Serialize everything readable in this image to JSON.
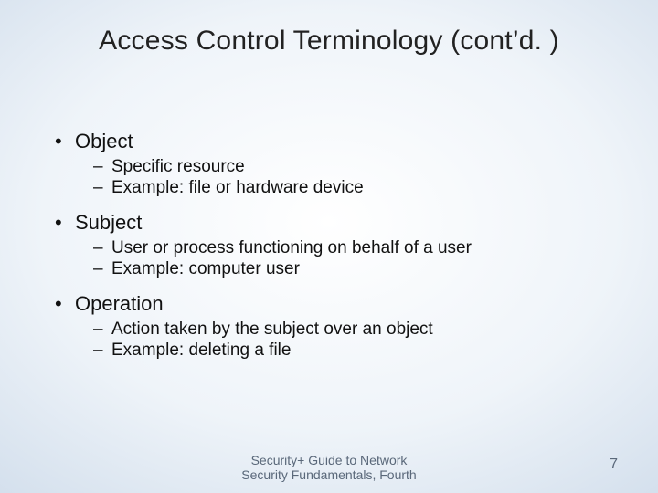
{
  "title": "Access Control Terminology (cont’d. )",
  "bullets": [
    {
      "label": "Object",
      "subs": [
        "Specific resource",
        "Example: file or hardware device"
      ]
    },
    {
      "label": "Subject",
      "subs": [
        "User or process functioning on behalf of a user",
        "Example: computer user"
      ]
    },
    {
      "label": "Operation",
      "subs": [
        "Action taken by the subject over an object",
        "Example: deleting a file"
      ]
    }
  ],
  "footer_line1": "Security+ Guide to Network",
  "footer_line2": "Security Fundamentals, Fourth",
  "page_number": "7"
}
